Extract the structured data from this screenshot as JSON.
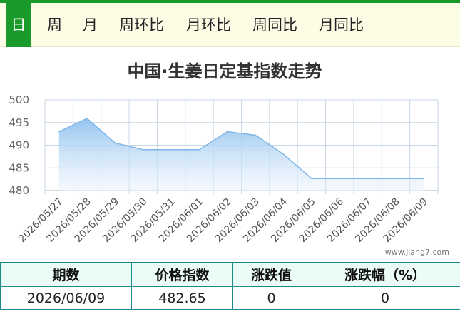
{
  "tabs": [
    {
      "label": "日",
      "active": true
    },
    {
      "label": "周",
      "active": false
    },
    {
      "label": "月",
      "active": false
    },
    {
      "label": "周环比",
      "active": false
    },
    {
      "label": "月环比",
      "active": false
    },
    {
      "label": "周同比",
      "active": false
    },
    {
      "label": "月同比",
      "active": false
    }
  ],
  "watermark": "www.jiang7.com",
  "colors": {
    "accent": "#1a9a2a",
    "line": "#7fb6e6",
    "area_top": "#8cc0ee",
    "table_border": "#1d8a8a",
    "table_header_bg": "#eafcf5"
  },
  "chart_data": {
    "type": "area",
    "title": "中国·生姜日定基指数走势",
    "categories": [
      "2026/05/27",
      "2026/05/28",
      "2026/05/29",
      "2026/05/30",
      "2026/05/31",
      "2026/06/01",
      "2026/06/02",
      "2026/06/03",
      "2026/06/04",
      "2026/06/05",
      "2026/06/06",
      "2026/06/07",
      "2026/06/08",
      "2026/06/09"
    ],
    "series": [
      {
        "values": [
          493,
          495.9,
          490.5,
          489,
          489,
          489,
          493,
          492.2,
          488,
          482.65,
          482.65,
          482.65,
          482.65,
          482.65
        ]
      }
    ],
    "ylim": [
      480,
      500
    ],
    "yticks": [
      480,
      485,
      490,
      495,
      500
    ],
    "grid": true
  },
  "table": {
    "headers": [
      "期数",
      "价格指数",
      "涨跌值",
      "涨跌幅（%）"
    ],
    "rows": [
      [
        "2026/06/09",
        "482.65",
        "0",
        "0"
      ]
    ]
  }
}
